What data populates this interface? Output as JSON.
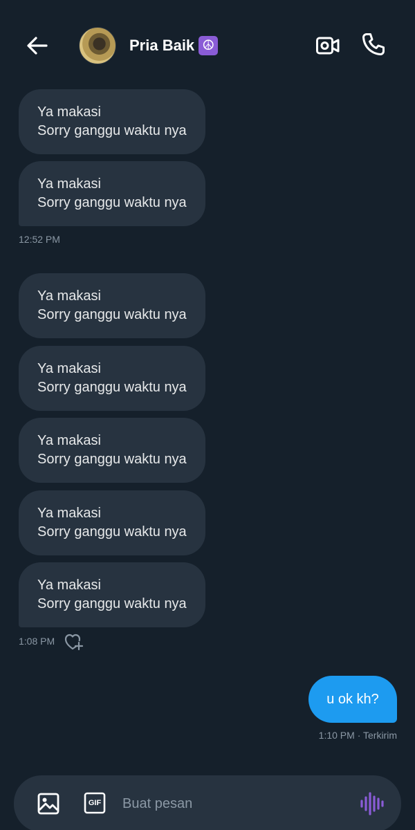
{
  "header": {
    "back_icon": "arrow-left-icon",
    "contact_name": "Pria Baik",
    "name_emoji": "☮",
    "video_icon": "video-call-icon",
    "call_icon": "phone-icon"
  },
  "messages": {
    "group1": [
      {
        "line1": "Ya makasi",
        "line2": "Sorry ganggu waktu nya"
      },
      {
        "line1": "Ya makasi",
        "line2": "Sorry ganggu waktu nya"
      }
    ],
    "group1_time": "12:52 PM",
    "group2": [
      {
        "line1": "Ya makasi",
        "line2": "Sorry ganggu waktu nya"
      },
      {
        "line1": "Ya makasi",
        "line2": "Sorry ganggu waktu nya"
      },
      {
        "line1": "Ya makasi",
        "line2": "Sorry ganggu waktu nya"
      },
      {
        "line1": "Ya makasi",
        "line2": "Sorry ganggu waktu nya"
      },
      {
        "line1": "Ya makasi",
        "line2": "Sorry ganggu waktu nya"
      }
    ],
    "group2_time": "1:08 PM",
    "react_icon": "heart-plus-icon",
    "sent": {
      "text": "u ok kh?",
      "meta": "1:10 PM · Terkirim"
    }
  },
  "composer": {
    "placeholder": "Buat pesan",
    "photo_icon": "image-icon",
    "gif_label": "GIF",
    "voice_icon": "voice-waveform-icon"
  },
  "colors": {
    "background": "#15202b",
    "bubble": "#273340",
    "sent_bubble": "#1d9bf0",
    "accent_voice": "#8a5cd6"
  }
}
